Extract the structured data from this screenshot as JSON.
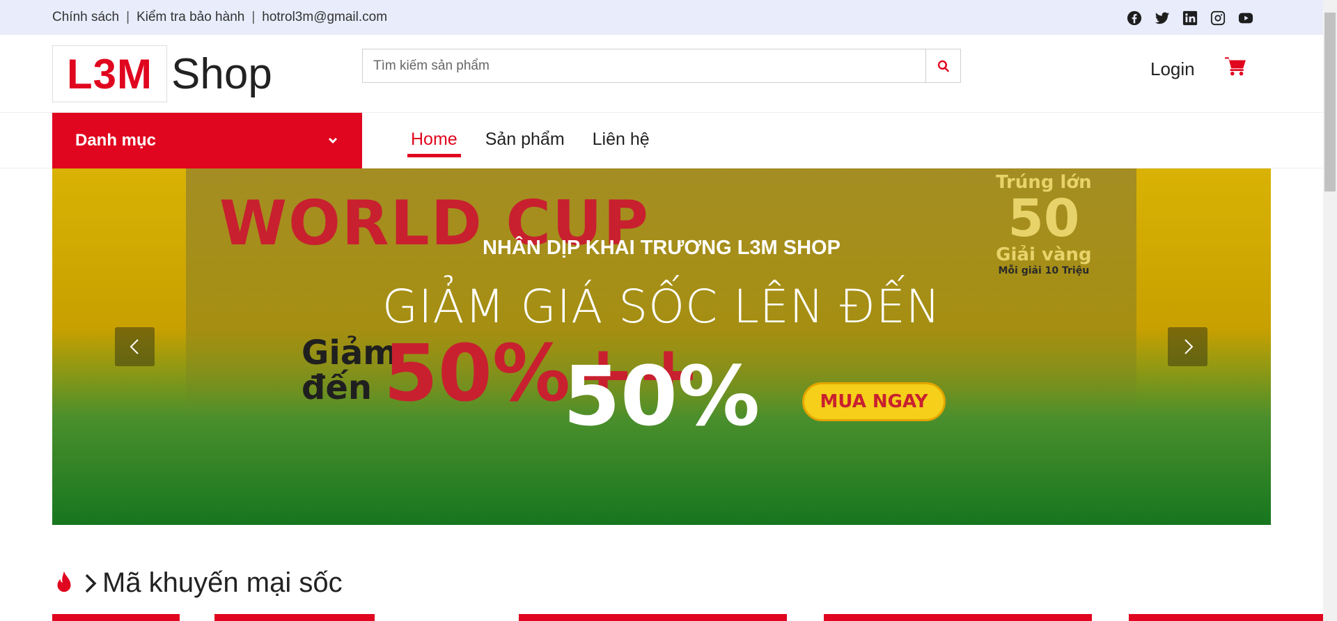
{
  "topbar": {
    "links": [
      "Chính sách",
      "Kiểm tra bảo hành",
      "hotrol3m@gmail.com"
    ],
    "social_icons": [
      "facebook-icon",
      "twitter-icon",
      "linkedin-icon",
      "instagram-icon",
      "youtube-icon"
    ]
  },
  "header": {
    "logo_mark": "L3M",
    "logo_text": "Shop",
    "search_placeholder": "Tìm kiếm sản phẩm",
    "login_label": "Login",
    "cart_icon": "cart-icon"
  },
  "nav": {
    "category_label": "Danh mục",
    "menu": [
      {
        "label": "Home",
        "active": true
      },
      {
        "label": "Sản phẩm",
        "active": false
      },
      {
        "label": "Liên hệ",
        "active": false
      }
    ]
  },
  "banner": {
    "line1": "NHÂN DỊP KHAI TRƯƠNG L3M SHOP",
    "line2": "GIẢM GIÁ SỐC LÊN ĐẾN",
    "line3": "50%",
    "art_worldcup": "WORLD CUP",
    "art_giam": "Giảm",
    "art_den": "đến",
    "art_percent": "50%++",
    "art_trung_lon": "Trúng lớn",
    "art_50": "50",
    "art_giai_vang": "Giải vàng",
    "art_moi_giai": "Mỗi giải 10 Triệu",
    "art_buy": "MUA NGAY"
  },
  "promo": {
    "title": "Mã khuyến mại sốc"
  },
  "colors": {
    "accent": "#e0061f",
    "topbar_bg": "#e8ecfb"
  }
}
